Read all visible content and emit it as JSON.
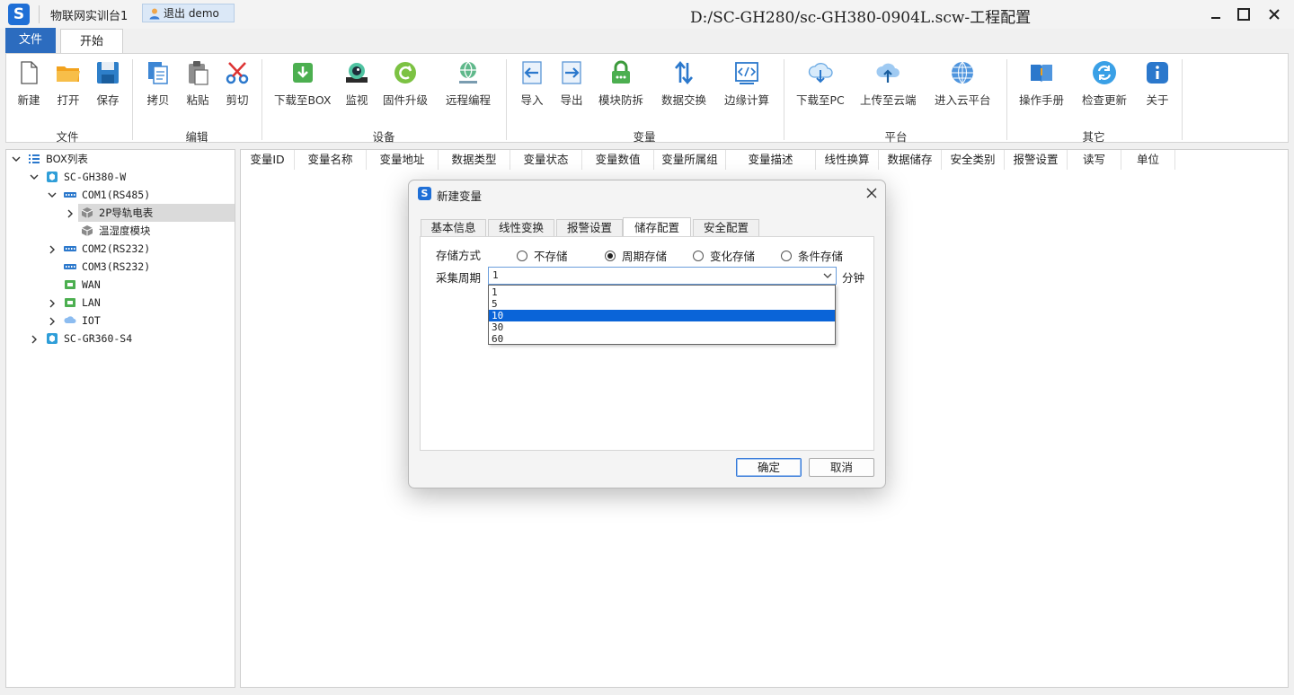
{
  "titlebar": {
    "station": "物联网实训台1",
    "logout": "退出 demo",
    "title": "D:/SC-GH280/sc-GH380-0904L.scw-工程配置"
  },
  "tabs": {
    "file": "文件",
    "start": "开始"
  },
  "ribbon": {
    "buttons": {
      "new": "新建",
      "open": "打开",
      "save": "保存",
      "copy": "拷贝",
      "paste": "粘贴",
      "cut": "剪切",
      "download_box": "下载至BOX",
      "monitor": "监视",
      "firmware": "固件升级",
      "remote": "远程编程",
      "import": "导入",
      "export": "导出",
      "anti": "模块防拆",
      "exchange": "数据交换",
      "edge": "边缘计算",
      "download_pc": "下载至PC",
      "upload_cloud": "上传至云端",
      "enter_cloud": "进入云平台",
      "manual": "操作手册",
      "update": "检查更新",
      "about": "关于"
    },
    "groups": {
      "file": "文件",
      "edit": "编辑",
      "device": "设备",
      "variable": "变量",
      "platform": "平台",
      "other": "其它"
    }
  },
  "tree": {
    "root": "BOX列表",
    "dev1": "SC-GH380-W",
    "com1": "COM1(RS485)",
    "meter": "2P导轨电表",
    "temp": "温湿度模块",
    "com2": "COM2(RS232)",
    "com3": "COM3(RS232)",
    "wan": "WAN",
    "lan": "LAN",
    "iot": "IOT",
    "dev2": "SC-GR360-S4"
  },
  "grid": {
    "columns": [
      "变量ID",
      "变量名称",
      "变量地址",
      "数据类型",
      "变量状态",
      "变量数值",
      "变量所属组",
      "变量描述",
      "线性换算",
      "数据储存",
      "安全类别",
      "报警设置",
      "读写",
      "单位"
    ]
  },
  "dialog": {
    "title": "新建变量",
    "tabs": [
      "基本信息",
      "线性变换",
      "报警设置",
      "储存配置",
      "安全配置"
    ],
    "storage_label": "存储方式",
    "radios": [
      "不存储",
      "周期存储",
      "变化存储",
      "条件存储"
    ],
    "period_label": "采集周期",
    "period_value": "1",
    "unit": "分钟",
    "options": [
      "1",
      "5",
      "10",
      "30",
      "60"
    ],
    "ok": "确定",
    "cancel": "取消"
  }
}
